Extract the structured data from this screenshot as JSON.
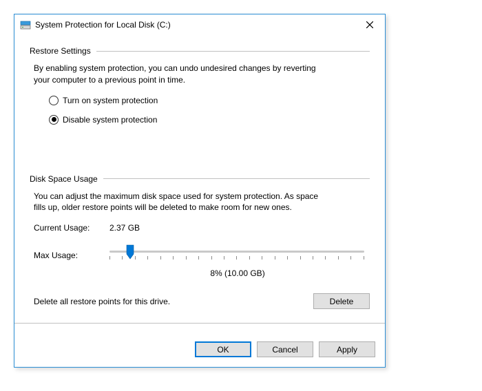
{
  "window": {
    "title": "System Protection for Local Disk (C:)"
  },
  "restore": {
    "header": "Restore Settings",
    "desc": "By enabling system protection, you can undo undesired changes by reverting your computer to a previous point in time.",
    "option_on": "Turn on system protection",
    "option_off": "Disable system protection",
    "selected": "off"
  },
  "disk": {
    "header": "Disk Space Usage",
    "desc": "You can adjust the maximum disk space used for system protection. As space fills up, older restore points will be deleted to make room for new ones.",
    "current_label": "Current Usage:",
    "current_value": "2.37 GB",
    "max_label": "Max Usage:",
    "slider_percent": 8,
    "slider_display": "8% (10.00 GB)",
    "delete_text": "Delete all restore points for this drive.",
    "delete_btn": "Delete"
  },
  "buttons": {
    "ok": "OK",
    "cancel": "Cancel",
    "apply": "Apply"
  }
}
